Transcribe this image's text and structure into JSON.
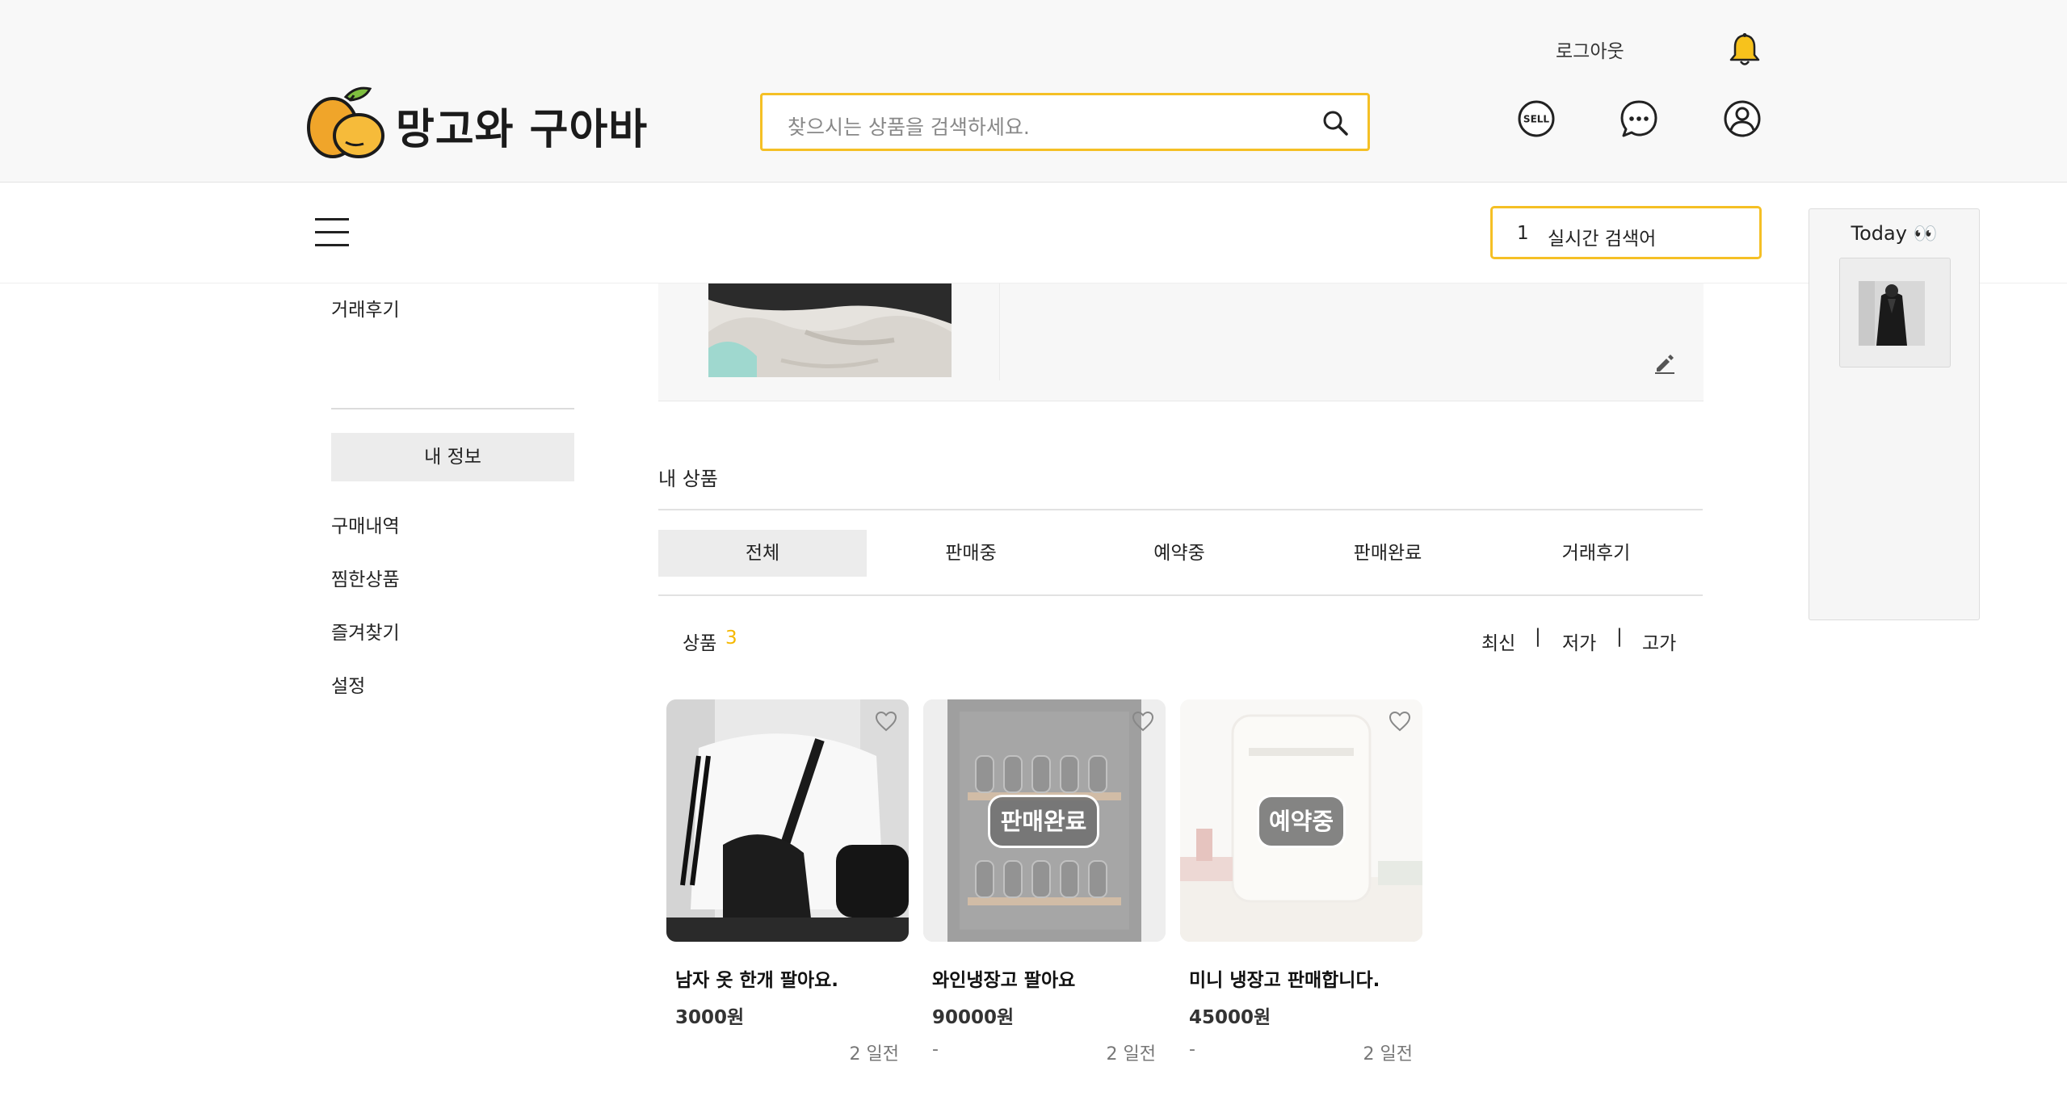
{
  "header": {
    "logout": "로그아웃",
    "logo_text": "망고와 구아바",
    "search_placeholder": "찾으시는 상품을 검색하세요.",
    "sell_icon_text": "SELL"
  },
  "realtime": {
    "rank": "1",
    "label": "실시간 검색어"
  },
  "today": {
    "title": "Today 👀"
  },
  "sidebar": {
    "review_link": "거래후기",
    "my_info": "내 정보",
    "links": [
      "구매내역",
      "찜한상품",
      "즐겨찾기",
      "설정"
    ]
  },
  "main": {
    "section_title": "내 상품",
    "tabs": [
      {
        "label": "전체",
        "active": true
      },
      {
        "label": "판매중",
        "active": false
      },
      {
        "label": "예약중",
        "active": false
      },
      {
        "label": "판매완료",
        "active": false
      },
      {
        "label": "거래후기",
        "active": false
      }
    ],
    "count_label": "상품",
    "count": "3",
    "sort": [
      "최신",
      "저가",
      "고가"
    ],
    "sort_sep": "|"
  },
  "products": [
    {
      "title": "남자 옷 한개 팔아요.",
      "price": "3000원",
      "status": "",
      "dash": "",
      "date": "2 일전"
    },
    {
      "title": "와인냉장고 팔아요",
      "price": "90000원",
      "status": "판매완료",
      "dash": "-",
      "date": "2 일전"
    },
    {
      "title": "미니 냉장고 판매합니다.",
      "price": "45000원",
      "status": "예약중",
      "dash": "-",
      "date": "2 일전"
    }
  ],
  "colors": {
    "accent": "#f5c025",
    "count": "#f5b800"
  }
}
